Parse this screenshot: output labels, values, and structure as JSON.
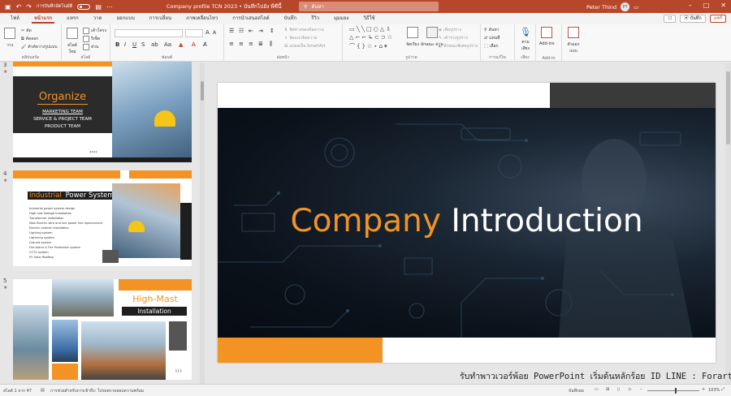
{
  "window": {
    "quick_access_label": "การบันทึกอัตโนมัติ",
    "doc_title": "Company profile TCN 2023 • บันทึกไปยัง พีซีนี้",
    "search_placeholder": "ค้นหา",
    "user_name": "Peter Thind",
    "user_initials": "PT"
  },
  "tabs": [
    "ไฟล์",
    "หน้าแรก",
    "แทรก",
    "วาด",
    "ออกแบบ",
    "การเปลี่ยน",
    "ภาพเคลื่อนไหว",
    "การนำเสนอสไลด์",
    "บันทึก",
    "รีวิว",
    "มุมมอง",
    "วิธีใช้"
  ],
  "active_tab": 1,
  "tab_buttons": {
    "comments": "☐",
    "record": "⦿ บันทึก",
    "share": "แชร์"
  },
  "ribbon": {
    "groups": [
      "คลิปบอร์ด",
      "สไลด์",
      "ฟอนต์",
      "ย่อหน้า",
      "รูปวาด",
      "การแก้ไข",
      "เสียง",
      "Add-in",
      ""
    ],
    "clipboard": {
      "paste": "วาง",
      "cut": "ตัด",
      "copy": "คัดลอก",
      "format_painter": "ตัวคัดวางรูปแบบ"
    },
    "slides": {
      "new_slide": "สไลด์ ใหม่",
      "layout": "เค้าโครง",
      "reset": "รีเซ็ต",
      "section": "ส่วน"
    },
    "paragraph": {
      "direction": "ทิศทางของข้อความ",
      "align": "จัดแนวข้อความ",
      "smartart": "แปลงเป็น SmartArt"
    },
    "drawing": {
      "arrange": "จัดเรียง",
      "quick_styles": "ลักษณะ ด่วน",
      "fill": "เติมรูปร่าง",
      "outline": "เค้าร่างรูปร่าง",
      "effects": "ลักษณะพิเศษรูปร่าง"
    },
    "editing": {
      "find": "ค้นหา",
      "replace": "แทนที่",
      "select": "เลือก"
    },
    "voice": {
      "dictate": "ตาม เสียง"
    },
    "addin": {
      "addins": "Add-ins",
      "designer": "ตัวออก แบบ"
    }
  },
  "thumbnails": [
    {
      "num": "3",
      "title": "Organize",
      "items": [
        "MARKETING TEAM",
        "SERVICE & PROJECT TEAM",
        "PRODUCT TEAM"
      ],
      "arrows": "‹‹‹‹"
    },
    {
      "num": "4",
      "title_a": "Industrial",
      "title_b": " Power System",
      "items": [
        "Industrial power system design",
        "High Low Voltage Installation",
        "Transformer installation",
        "New Electric wire and line power line replacement",
        "Electric cabinet installation",
        "Lighting system",
        "Lightning system",
        "Ground system",
        "Fire Alarm & Fire Protection system",
        "CCTV system",
        "PV Solar Rooftop"
      ]
    },
    {
      "num": "5",
      "title_a": "High-Mast",
      "title_b": "Installation"
    }
  ],
  "main_slide": {
    "title_a": "Company",
    "title_b": " Introduction"
  },
  "watermark": "รับทำพาวเวอร์พ้อย PowerPoint เริ่มต้นหลักร้อย ID LINE : Forartwork",
  "status": {
    "slide_info": "สไลด์ 1 จาก 47",
    "accessibility": "การช่วยสำหรับการเข้าถึง: โปรดตรวจสอบความพร้อม",
    "notes": "บันทึกย่อ",
    "zoom": "103%"
  },
  "colors": {
    "accent": "#b7472a",
    "orange": "#f29323",
    "dark": "#1e1e1e"
  }
}
